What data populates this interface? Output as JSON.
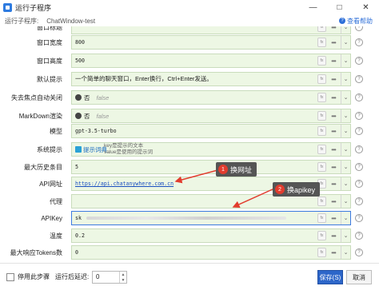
{
  "window": {
    "title": "运行子程序"
  },
  "subheader": {
    "label": "运行子程序:",
    "value": "ChatWindow-test",
    "help_link": "查看帮助"
  },
  "fields": {
    "top_partial": {
      "label": "窗口标题"
    },
    "width": {
      "label": "窗口宽度",
      "value": "800"
    },
    "height": {
      "label": "窗口高度",
      "value": "500"
    },
    "default_hint": {
      "label": "默认提示",
      "value": "一个简单的聊天窗口，Enter换行，Ctrl+Enter发送。"
    },
    "lose_focus": {
      "label": "失去焦点自动关闭",
      "option_label": "否",
      "option_value": "false"
    },
    "markdown": {
      "label": "MarkDown渲染",
      "option_label": "否",
      "option_value": "false"
    },
    "model": {
      "label": "模型",
      "value": "gpt-3.5-turbo"
    },
    "system_prompt": {
      "label": "系统提示",
      "chip": "提示词典",
      "hint_line1": "key是提示的文本",
      "hint_line2": "value是使用的提示词"
    },
    "max_history": {
      "label": "最大历史条目",
      "value": "5"
    },
    "api_url": {
      "label": "API网址",
      "value": "https://api.chatanywhere.com.cn"
    },
    "proxy": {
      "label": "代理",
      "value": ""
    },
    "api_key": {
      "label": "APIKey",
      "value": "sk"
    },
    "temperature": {
      "label": "温度",
      "value": "0.2"
    },
    "max_tokens": {
      "label": "最大响应Tokens数",
      "value": "0"
    }
  },
  "callouts": [
    {
      "number": "1",
      "text": "换网址"
    },
    {
      "number": "2",
      "text": "换apikey"
    }
  ],
  "footer": {
    "disable_step_label": "停用此步骤",
    "delay_label": "运行后延迟:",
    "delay_value": "0",
    "save_button": "保存(S)",
    "cancel_button": "取消"
  },
  "colors": {
    "field_bg": "#edf7e4",
    "accent": "#2d66c9",
    "callout_bg": "#555555",
    "badge_red": "#e23c2e",
    "arrow_red": "#e23c2e"
  },
  "icons": {
    "app": "app-icon",
    "help": "question-circle-icon",
    "dropdown": "chevron-down-icon",
    "more": "ellipsis-icon"
  }
}
